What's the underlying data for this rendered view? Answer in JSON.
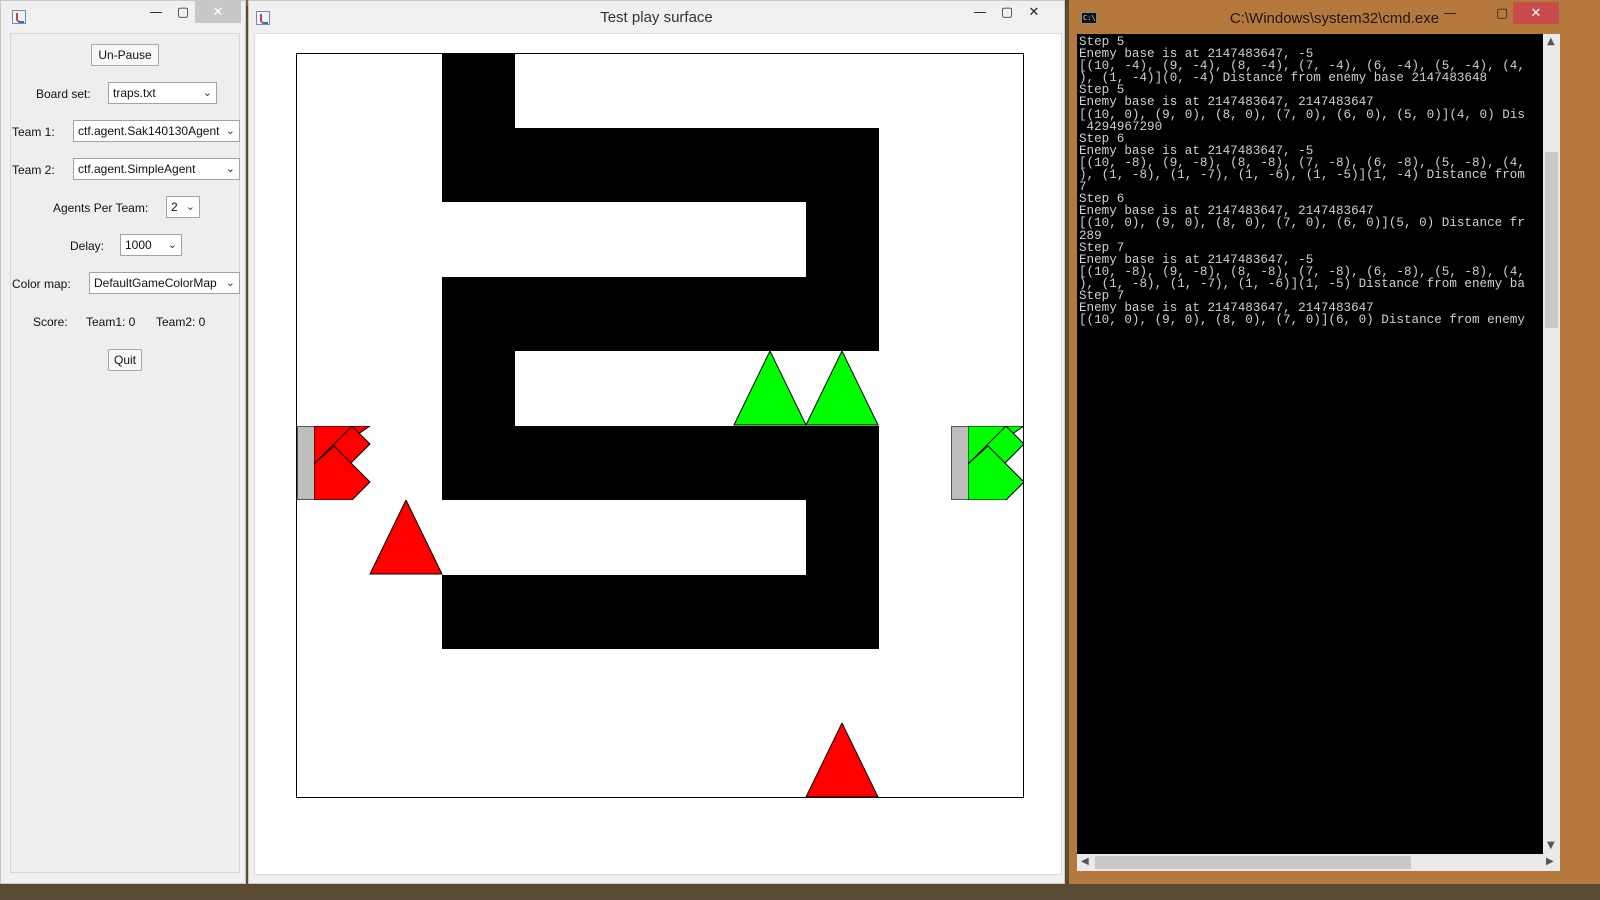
{
  "control_panel": {
    "pause_button": "Un-Pause",
    "board_set_label": "Board set:",
    "board_set_value": "traps.txt",
    "team1_label": "Team 1:",
    "team1_value": "ctf.agent.Sak140130Agent",
    "team2_label": "Team 2:",
    "team2_value": "ctf.agent.SimpleAgent",
    "agents_per_team_label": "Agents Per Team:",
    "agents_per_team_value": "2",
    "delay_label": "Delay:",
    "delay_value": "1000",
    "color_map_label": "Color map:",
    "color_map_value": "DefaultGameColorMap",
    "score_label": "Score:",
    "team1_score": "Team1: 0",
    "team2_score": "Team2: 0",
    "quit_button": "Quit"
  },
  "game_window": {
    "title": "Test play surface"
  },
  "board": {
    "team1_color": "#ff0000",
    "team2_color": "#00ff00",
    "wall_color": "#000000",
    "base_color": "#bdbdbd"
  },
  "console": {
    "title": "C:\\Windows\\system32\\cmd.exe",
    "lines": [
      "Step 5",
      "Enemy base is at 2147483647, -5",
      "[(10, -4), (9, -4), (8, -4), (7, -4), (6, -4), (5, -4), (4,",
      "), (1, -4)](0, -4) Distance from enemy base 2147483648",
      "Step 5",
      "Enemy base is at 2147483647, 2147483647",
      "[(10, 0), (9, 0), (8, 0), (7, 0), (6, 0), (5, 0)](4, 0) Dis",
      " 4294967290",
      "Step 6",
      "Enemy base is at 2147483647, -5",
      "[(10, -8), (9, -8), (8, -8), (7, -8), (6, -8), (5, -8), (4,",
      "), (1, -8), (1, -7), (1, -6), (1, -5)](1, -4) Distance from",
      "7",
      "Step 6",
      "Enemy base is at 2147483647, 2147483647",
      "[(10, 0), (9, 0), (8, 0), (7, 0), (6, 0)](5, 0) Distance fr",
      "289",
      "Step 7",
      "Enemy base is at 2147483647, -5",
      "[(10, -8), (9, -8), (8, -8), (7, -8), (6, -8), (5, -8), (4,",
      "), (1, -8), (1, -7), (1, -6)](1, -5) Distance from enemy ba",
      "Step 7",
      "Enemy base is at 2147483647, 2147483647",
      "[(10, 0), (9, 0), (8, 0), (7, 0)](6, 0) Distance from enemy"
    ]
  },
  "window_controls": {
    "minimize": "—",
    "maximize": "▢",
    "close": "✕"
  }
}
